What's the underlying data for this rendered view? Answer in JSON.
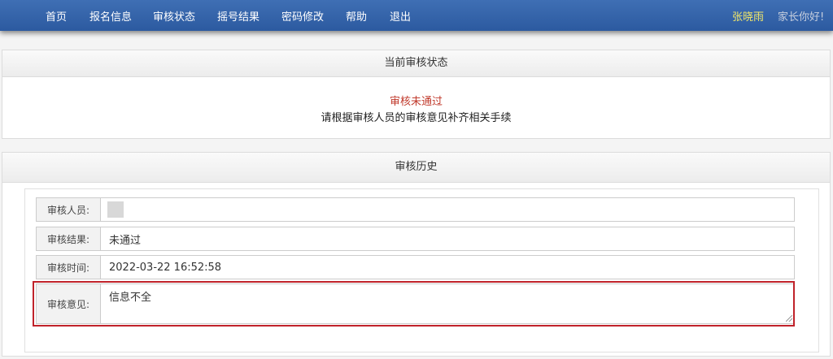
{
  "nav": {
    "items": [
      "首页",
      "报名信息",
      "审核状态",
      "摇号结果",
      "密码修改",
      "帮助",
      "退出"
    ],
    "user_name": "张晓雨",
    "greeting": "家长你好!"
  },
  "status_panel": {
    "title": "当前审核状态",
    "status": "审核未通过",
    "note": "请根据审核人员的审核意见补齐相关手续"
  },
  "history_panel": {
    "title": "审核历史",
    "reviewer_label": "审核人员:",
    "result_label": "审核结果:",
    "result_value": "未通过",
    "time_label": "审核时间:",
    "time_value": "2022-03-22 16:52:58",
    "opinion_label": "审核意见:",
    "opinion_value": "信息不全"
  },
  "colors": {
    "nav_bg": "#2c5aa0",
    "status_red": "#c0392b",
    "highlight": "#c0222a",
    "user_yellow": "#f0e66a"
  }
}
